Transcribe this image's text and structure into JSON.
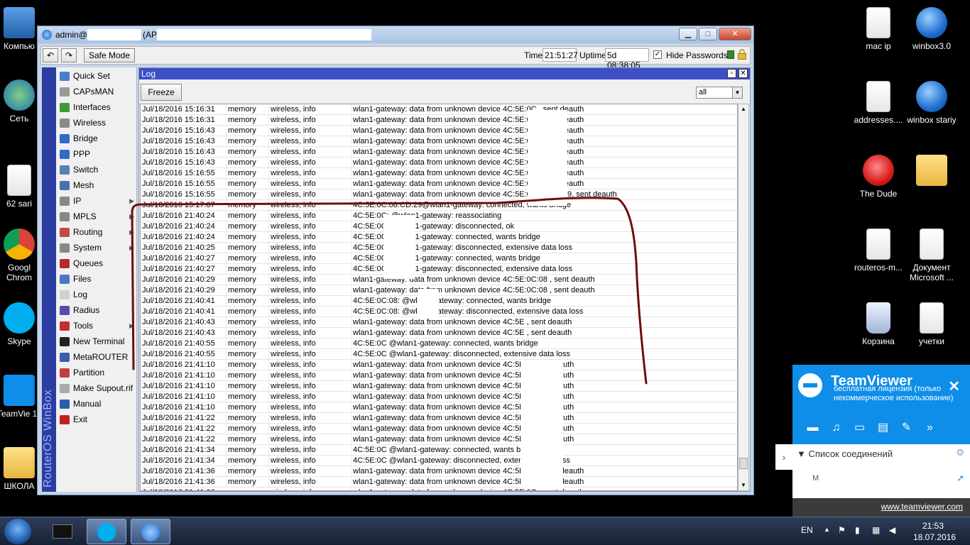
{
  "desktop": {
    "left_icons": [
      {
        "label": "Компью",
        "icon": "computer-icon"
      },
      {
        "label": "Сеть",
        "icon": "network-icon"
      },
      {
        "label": "62 sari",
        "icon": "file-icon"
      },
      {
        "label": "Googl Chrom",
        "icon": "chrome-icon"
      },
      {
        "label": "Skype",
        "icon": "skype-icon"
      },
      {
        "label": "TeamVie 11",
        "icon": "teamviewer-icon"
      },
      {
        "label": "ШКОЛА",
        "icon": "folder-icon"
      }
    ],
    "right_icons": [
      {
        "label": "mac ip",
        "icon": "file-icon"
      },
      {
        "label": "winbox3.0",
        "icon": "winbox-icon"
      },
      {
        "label": "addresses....",
        "icon": "file-icon"
      },
      {
        "label": "winbox stariy",
        "icon": "winbox-icon"
      },
      {
        "label": "The Dude",
        "icon": "dude-icon"
      },
      {
        "label": "",
        "icon": "folder-icon"
      },
      {
        "label": "routeros-m...",
        "icon": "file-icon"
      },
      {
        "label": "Документ Microsoft ...",
        "icon": "docx-icon"
      },
      {
        "label": "Корзина",
        "icon": "recycle-bin-icon"
      },
      {
        "label": "учетки",
        "icon": "file-icon"
      }
    ]
  },
  "window": {
    "title_prefix": "admin@",
    "title_mid": "(AP",
    "undo_icon": "undo-icon",
    "redo_icon": "redo-icon",
    "safe_mode_label": "Safe Mode",
    "time_label": "Time:",
    "time_value": "21:51:27",
    "uptime_label": "Uptime:",
    "uptime_value": "5d 08:38:05",
    "hide_passwords_checked": "✓",
    "hide_passwords_label": "Hide Passwords",
    "brand_vertical": "RouterOS WinBox"
  },
  "menu": [
    {
      "label": "Quick Set",
      "icon": "quickset-icon",
      "color": "#4a7dd4",
      "arrow": ""
    },
    {
      "label": "CAPsMAN",
      "icon": "capsman-icon",
      "color": "#999999",
      "arrow": ""
    },
    {
      "label": "Interfaces",
      "icon": "interfaces-icon",
      "color": "#3a9b3a",
      "arrow": ""
    },
    {
      "label": "Wireless",
      "icon": "wireless-icon",
      "color": "#8a8a8a",
      "arrow": ""
    },
    {
      "label": "Bridge",
      "icon": "bridge-icon",
      "color": "#2f6cc4",
      "arrow": ""
    },
    {
      "label": "PPP",
      "icon": "ppp-icon",
      "color": "#2f6cc4",
      "arrow": ""
    },
    {
      "label": "Switch",
      "icon": "switch-icon",
      "color": "#5a7fb0",
      "arrow": ""
    },
    {
      "label": "Mesh",
      "icon": "mesh-icon",
      "color": "#4a6fb0",
      "arrow": ""
    },
    {
      "label": "IP",
      "icon": "ip-icon",
      "color": "#888888",
      "arrow": "▶"
    },
    {
      "label": "MPLS",
      "icon": "mpls-icon",
      "color": "#888888",
      "arrow": "▶"
    },
    {
      "label": "Routing",
      "icon": "routing-icon",
      "color": "#c04a4a",
      "arrow": "▶"
    },
    {
      "label": "System",
      "icon": "system-icon",
      "color": "#888888",
      "arrow": "▶"
    },
    {
      "label": "Queues",
      "icon": "queues-icon",
      "color": "#b52a2a",
      "arrow": ""
    },
    {
      "label": "Files",
      "icon": "files-icon",
      "color": "#4a78c0",
      "arrow": ""
    },
    {
      "label": "Log",
      "icon": "log-icon",
      "color": "#d0d0d0",
      "arrow": ""
    },
    {
      "label": "Radius",
      "icon": "radius-icon",
      "color": "#5a4ab0",
      "arrow": ""
    },
    {
      "label": "Tools",
      "icon": "tools-icon",
      "color": "#c03030",
      "arrow": "▶"
    },
    {
      "label": "New Terminal",
      "icon": "terminal-icon",
      "color": "#222222",
      "arrow": ""
    },
    {
      "label": "MetaROUTER",
      "icon": "metarouter-icon",
      "color": "#3a5fa8",
      "arrow": ""
    },
    {
      "label": "Partition",
      "icon": "partition-icon",
      "color": "#c04040",
      "arrow": ""
    },
    {
      "label": "Make Supout.rif",
      "icon": "supout-icon",
      "color": "#aaaaaa",
      "arrow": ""
    },
    {
      "label": "Manual",
      "icon": "manual-icon",
      "color": "#2a5fb0",
      "arrow": ""
    },
    {
      "label": "Exit",
      "icon": "exit-icon",
      "color": "#c02020",
      "arrow": ""
    }
  ],
  "log": {
    "title": "Log",
    "restore_icon": "restore-icon",
    "close_icon": "close-icon",
    "freeze_label": "Freeze",
    "filter_value": "all",
    "rows": [
      [
        "Jul/18/2016 15:16:31",
        "memory",
        "wireless, info",
        "wlan1-gateway: data from unknown device 4C:5E:0C                      , sent deauth"
      ],
      [
        "Jul/18/2016 15:16:31",
        "memory",
        "wireless, info",
        "wlan1-gateway: data from unknown device 4C:5E:0C                      , sent deauth"
      ],
      [
        "Jul/18/2016 15:16:43",
        "memory",
        "wireless, info",
        "wlan1-gateway: data from unknown device 4C:5E:0C                      , sent deauth"
      ],
      [
        "Jul/18/2016 15:16:43",
        "memory",
        "wireless, info",
        "wlan1-gateway: data from unknown device 4C:5E:0C                      , sent deauth"
      ],
      [
        "Jul/18/2016 15:16:43",
        "memory",
        "wireless, info",
        "wlan1-gateway: data from unknown device 4C:5E:0C                      , sent deauth"
      ],
      [
        "Jul/18/2016 15:16:43",
        "memory",
        "wireless, info",
        "wlan1-gateway: data from unknown device 4C:5E:0C                      , sent deauth"
      ],
      [
        "Jul/18/2016 15:16:55",
        "memory",
        "wireless, info",
        "wlan1-gateway: data from unknown device 4C:5E:0C                      , sent deauth"
      ],
      [
        "Jul/18/2016 15:16:55",
        "memory",
        "wireless, info",
        "wlan1-gateway: data from unknown device 4C:5E:0C                      , sent deauth"
      ],
      [
        "Jul/18/2016 15:16:55",
        "memory",
        "wireless, info",
        "wlan1-gateway: data from unknown device 4C:5E:0C:08:CD:29, sent deauth"
      ],
      [
        "Jul/18/2016 15:17:07",
        "memory",
        "wireless, info",
        "4C:5E:0C:08:CD:29@wlan1-gateway: connected, wants bridge"
      ],
      [
        "Jul/18/2016 21:40:24",
        "memory",
        "wireless, info",
        "4C:5E:0C:          @wlan1-gateway: reassociating"
      ],
      [
        "Jul/18/2016 21:40:24",
        "memory",
        "wireless, info",
        "4C:5E:0C:          @wlan1-gateway: disconnected, ok"
      ],
      [
        "Jul/18/2016 21:40:24",
        "memory",
        "wireless, info",
        "4C:5E:0C:          @wlan1-gateway: connected, wants bridge"
      ],
      [
        "Jul/18/2016 21:40:25",
        "memory",
        "wireless, info",
        "4C:5E:0C:          @wlan1-gateway: disconnected, extensive data loss"
      ],
      [
        "Jul/18/2016 21:40:27",
        "memory",
        "wireless, info",
        "4C:5E:0C:          @wlan1-gateway: connected, wants bridge"
      ],
      [
        "Jul/18/2016 21:40:27",
        "memory",
        "wireless, info",
        "4C:5E:0C:          @wlan1-gateway: disconnected, extensive data loss"
      ],
      [
        "Jul/18/2016 21:40:29",
        "memory",
        "wireless, info",
        "wlan1-gateway: data from unknown device 4C:5E:0C:08              , sent deauth"
      ],
      [
        "Jul/18/2016 21:40:29",
        "memory",
        "wireless, info",
        "wlan1-gateway: data from unknown device 4C:5E:0C:08              , sent deauth"
      ],
      [
        "Jul/18/2016 21:40:41",
        "memory",
        "wireless, info",
        "4C:5E:0C:08:         @wlan1-gateway: connected, wants bridge"
      ],
      [
        "Jul/18/2016 21:40:41",
        "memory",
        "wireless, info",
        "4C:5E:0C:08:         @wlan1-gateway: disconnected, extensive data loss"
      ],
      [
        "Jul/18/2016 21:40:43",
        "memory",
        "wireless, info",
        "wlan1-gateway: data from unknown device 4C:5E                       , sent deauth"
      ],
      [
        "Jul/18/2016 21:40:43",
        "memory",
        "wireless, info",
        "wlan1-gateway: data from unknown device 4C:5E                       , sent deauth"
      ],
      [
        "Jul/18/2016 21:40:55",
        "memory",
        "wireless, info",
        "4C:5E:0C             @wlan1-gateway: connected, wants bridge"
      ],
      [
        "Jul/18/2016 21:40:55",
        "memory",
        "wireless, info",
        "4C:5E:0C             @wlan1-gateway: disconnected, extensive data loss"
      ],
      [
        "Jul/18/2016 21:41:10",
        "memory",
        "wireless, info",
        "wlan1-gateway: data from unknown device 4C:5E:                      , sent deauth"
      ],
      [
        "Jul/18/2016 21:41:10",
        "memory",
        "wireless, info",
        "wlan1-gateway: data from unknown device 4C:5E:                      , sent deauth"
      ],
      [
        "Jul/18/2016 21:41:10",
        "memory",
        "wireless, info",
        "wlan1-gateway: data from unknown device 4C:5E:                      , sent deauth"
      ],
      [
        "Jul/18/2016 21:41:10",
        "memory",
        "wireless, info",
        "wlan1-gateway: data from unknown device 4C:5E:                      , sent deauth"
      ],
      [
        "Jul/18/2016 21:41:10",
        "memory",
        "wireless, info",
        "wlan1-gateway: data from unknown device 4C:5E:                      , sent deauth"
      ],
      [
        "Jul/18/2016 21:41:22",
        "memory",
        "wireless, info",
        "wlan1-gateway: data from unknown device 4C:5E:                      , sent deauth"
      ],
      [
        "Jul/18/2016 21:41:22",
        "memory",
        "wireless, info",
        "wlan1-gateway: data from unknown device 4C:5E:                      , sent deauth"
      ],
      [
        "Jul/18/2016 21:41:22",
        "memory",
        "wireless, info",
        "wlan1-gateway: data from unknown device 4C:5E:                      , sent deauth"
      ],
      [
        "Jul/18/2016 21:41:34",
        "memory",
        "wireless, info",
        "4C:5E:0C             @wlan1-gateway: connected, wants bridge"
      ],
      [
        "Jul/18/2016 21:41:34",
        "memory",
        "wireless, info",
        "4C:5E:0C             @wlan1-gateway: disconnected, extensive data loss"
      ],
      [
        "Jul/18/2016 21:41:36",
        "memory",
        "wireless, info",
        "wlan1-gateway: data from unknown device 4C:5E:0C                      , sent deauth"
      ],
      [
        "Jul/18/2016 21:41:36",
        "memory",
        "wireless, info",
        "wlan1-gateway: data from unknown device 4C:5E:0C                      , sent deauth"
      ],
      [
        "Jul/18/2016 21:41:36",
        "memory",
        "wireless, info",
        "wlan1-gateway: data from unknown device 4C:5E:0C                      , sent deauth"
      ]
    ]
  },
  "teamviewer": {
    "brand": "TeamViewer",
    "license": "бесплатная лицензия (только некоммерческое использование)",
    "close": "✕",
    "connections_label": "▼ Список соединений",
    "field_placeholder": "М",
    "link": "www.teamviewer.com"
  },
  "taskbar": {
    "lang": "EN",
    "time": "21:53",
    "date": "18.07.2016"
  },
  "colors": {
    "log_title_bg": "#3d4fc4",
    "sidebar_strip": "#2b3da0",
    "annotation_stroke": "#6e0d0d",
    "teamviewer_blue": "#0e8ee9"
  }
}
